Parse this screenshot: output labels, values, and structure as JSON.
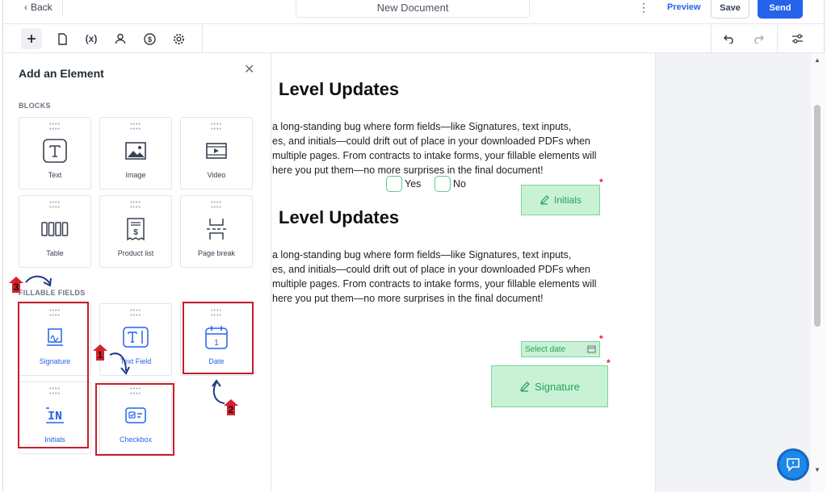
{
  "header": {
    "back_label": "Back",
    "document_title": "New Document",
    "preview_label": "Preview",
    "save_label": "Save",
    "send_label": "Send"
  },
  "toolbar": {
    "tools": [
      "plus-icon",
      "page-icon",
      "variable-icon",
      "user-icon",
      "dollar-icon",
      "gear-icon"
    ],
    "variable_label": "(x)",
    "right_tools": [
      "undo-icon",
      "redo-icon",
      "sliders-icon"
    ]
  },
  "panel": {
    "title": "Add an Element",
    "blocks_label": "BLOCKS",
    "blocks": [
      {
        "label": "Text",
        "icon": "text-block-icon"
      },
      {
        "label": "Image",
        "icon": "image-icon"
      },
      {
        "label": "Video",
        "icon": "video-icon"
      },
      {
        "label": "Table",
        "icon": "table-icon"
      },
      {
        "label": "Product list",
        "icon": "product-list-icon"
      },
      {
        "label": "Page break",
        "icon": "page-break-icon"
      }
    ],
    "fields_label": "FILLABLE FIELDS",
    "fields": [
      {
        "label": "Signature",
        "icon": "signature-icon"
      },
      {
        "label": "Text Field",
        "icon": "text-field-icon"
      },
      {
        "label": "Date",
        "icon": "calendar-icon"
      },
      {
        "label": "Initials",
        "icon": "initials-icon"
      },
      {
        "label": "Checkbox",
        "icon": "checkbox-icon"
      }
    ],
    "badges": [
      "1",
      "2",
      "3"
    ]
  },
  "document": {
    "heading": "Level Updates",
    "paragraph_lines": [
      "a long-standing bug where form fields—like Signatures, text inputs,",
      "es, and initials—could drift out of place in your downloaded PDFs when",
      " multiple pages. From contracts to intake forms, your fillable elements will",
      "here you put them—no more surprises in the final document!"
    ],
    "yes_label": "Yes",
    "no_label": "No",
    "initials_label": "Initials",
    "date_placeholder": "Select date",
    "signature_label": "Signature",
    "required_marker": "*"
  },
  "colors": {
    "accent": "#2563eb",
    "highlight": "#c91d2a",
    "field_fill": "#c8f1d5",
    "field_text": "#27a259"
  }
}
